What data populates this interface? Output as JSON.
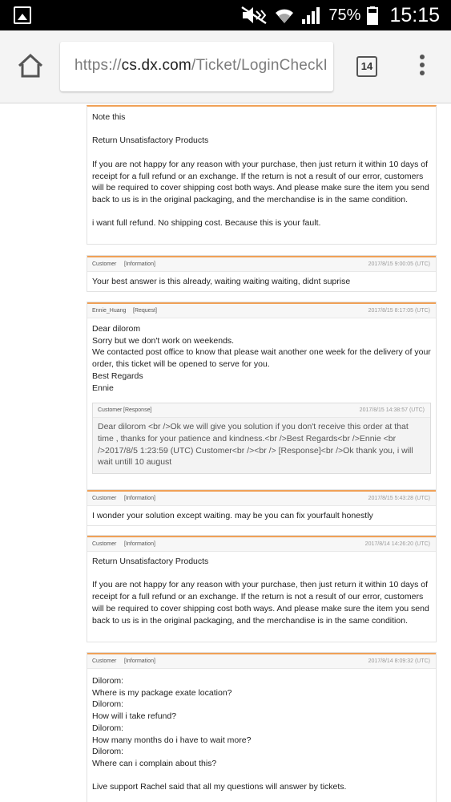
{
  "status_bar": {
    "battery": "75%",
    "time": "15:15"
  },
  "browser": {
    "url_prefix": "https://",
    "url_domain": "cs.dx.com",
    "url_path": "/Ticket/LoginCheckI",
    "tab_count": "14"
  },
  "messages": [
    {
      "body": "Note this\n\nReturn Unsatisfactory Products\n\nIf you are not happy for any reason with your purchase, then just return it within 10 days of receipt for a full refund or an exchange. If the return is not a result of our error, customers will be required to cover shipping cost both ways. And please make sure the item you send back to us is in the original packaging, and the merchandise is in the same condition.\n\ni want full refund. No shipping cost. Because this is your fault."
    },
    {
      "author": "Customer",
      "tag": "[Information]",
      "time": "2017/8/15 9:00:05 (UTC)",
      "body": "Your best answer is this already, waiting waiting waiting, didnt suprise"
    },
    {
      "author": "Ennie_Huang",
      "tag": "[Request]",
      "time": "2017/8/15 8:17:05 (UTC)",
      "body": "Dear dilorom\nSorry but we don't work on weekends.\nWe contacted post office to know that please wait another one week for the delivery of your order, this ticket will be opened to serve for you.\nBest Regards\nEnnie",
      "quote": {
        "author": "Customer",
        "tag": "[Response]",
        "time": "2017/8/15 14:38:57 (UTC)",
        "body": "Dear dilorom <br />Ok we will give you solution if you don't receive this order at that time , thanks for your patience and kindness.<br />Best Regards<br />Ennie <br />2017/8/5 1:23:59 (UTC) Customer<br /><br /> [Response]<br />Ok thank you, i will wait untill 10 august"
      }
    },
    {
      "author": "Customer",
      "tag": "[Information]",
      "time": "2017/8/15 5:43:28 (UTC)",
      "body": "I wonder your solution except waiting. may be you can fix yourfault honestly"
    },
    {
      "author": "Customer",
      "tag": "[Information]",
      "time": "2017/8/14 14:26:20 (UTC)",
      "body": "Return Unsatisfactory Products\n\nIf you are not happy for any reason with your purchase, then just return it within 10 days of receipt for a full refund or an exchange. If the return is not a result of our error, customers will be required to cover shipping cost both ways. And please make sure the item you send back to us is in the original packaging, and the merchandise is in the same condition."
    },
    {
      "author": "Customer",
      "tag": "[Information]",
      "time": "2017/8/14 8:09:32 (UTC)",
      "body": "Dilorom:\nWhere is my package exate location?\nDilorom:\nHow will i take refund?\nDilorom:\nHow many months do i have to wait more?\nDilorom:\nWhere can i complain about this?\n\nLive support Rachel said that all my questions will answer by tickets."
    }
  ]
}
